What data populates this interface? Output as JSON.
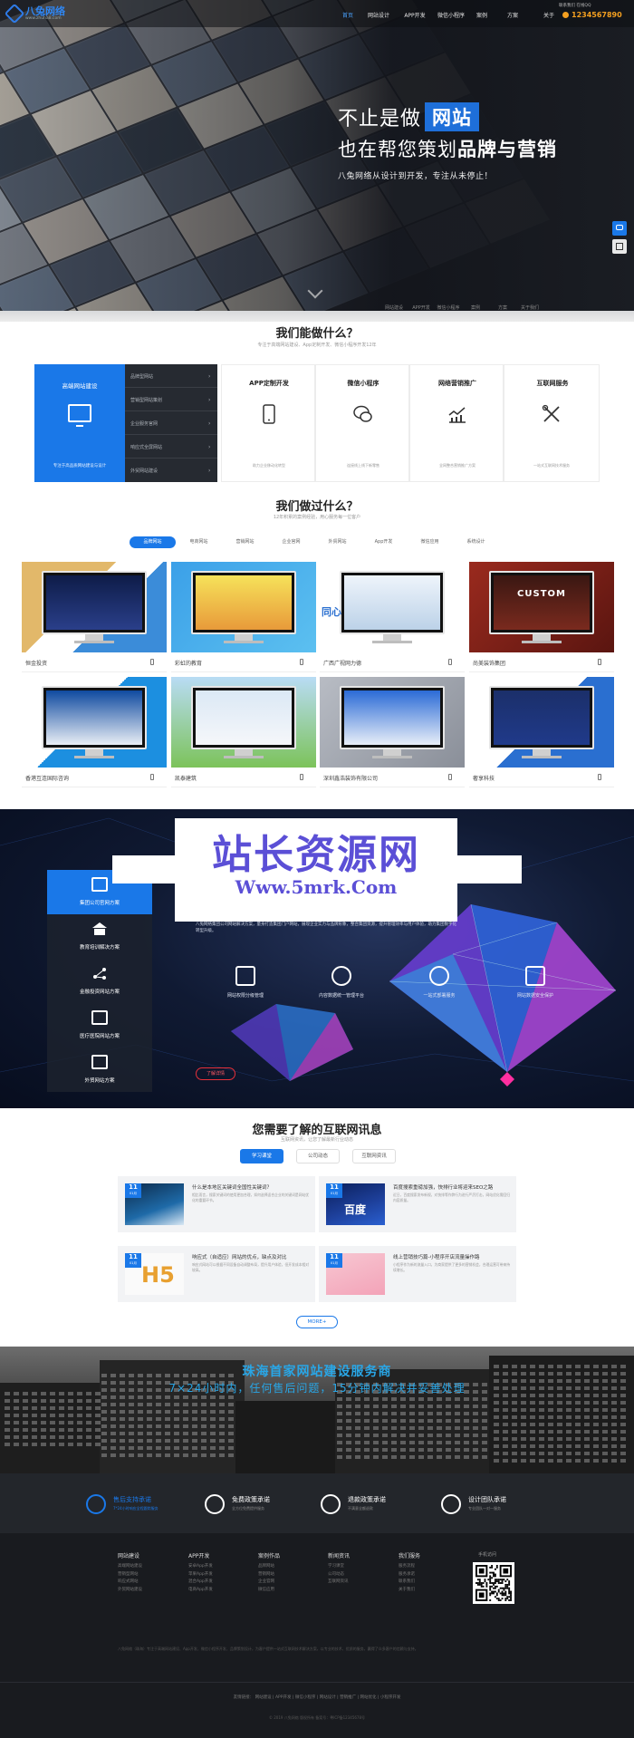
{
  "header": {
    "logo_text": "八兔网络",
    "logo_sub": "www.zhuha8.com",
    "contact_top": "联系我们  在线QQ",
    "phone": "1234567890",
    "nav": [
      "首页",
      "网站设计",
      "APP开发",
      "微信小程序",
      "案例",
      "方案",
      "关于"
    ]
  },
  "hero": {
    "line1_prefix": "不止是做",
    "line1_badge": "网站",
    "line2_prefix": "也在帮您策划",
    "line2_bold": "品牌与营销",
    "line3": "八兔网络从设计到开发，专注从未停止！",
    "footnav": [
      "网站建设",
      "APP开发",
      "微信小程序",
      "案例",
      "方案",
      "关于我们"
    ]
  },
  "services": {
    "title": "我们能做什么？",
    "subtitle": "专注于高端网站建设、App定制开发、微信小程序开发12年",
    "featured_title": "高端网站建设",
    "featured_note": "专注于高品质网站建设与设计",
    "menu": [
      "品牌型网站",
      "营销型网站策划",
      "企业服务官网",
      "响应式全屏网站",
      "外贸网站建设"
    ],
    "cards": [
      {
        "title": "APP定制开发",
        "desc": "助力企业移动化转型"
      },
      {
        "title": "微信小程序",
        "desc": "连接线上线下新零售"
      },
      {
        "title": "网络营销推广",
        "desc": "全网整合营销推广方案"
      },
      {
        "title": "互联网服务",
        "desc": "一站式互联网技术服务"
      }
    ]
  },
  "portfolio": {
    "title": "我们做过什么？",
    "subtitle": "12年积累的案例经验，用心服务每一位客户",
    "tabs": [
      "品牌网站",
      "电商网站",
      "营销网站",
      "企业官网",
      "外贸网站",
      "App开发",
      "微信应用",
      "系统设计"
    ],
    "items": [
      {
        "name": "恒金投资"
      },
      {
        "name": "彩虹的教育"
      },
      {
        "name": "广西广视网力德"
      },
      {
        "name": "尚美装饰集团"
      },
      {
        "name": "香港互连国际咨询"
      },
      {
        "name": "凯泰建筑"
      },
      {
        "name": "深圳鑫浩装饰有限公司"
      },
      {
        "name": "奢享科技"
      }
    ],
    "case_texts": [
      "CUSTOM",
      "同心"
    ]
  },
  "solutions": {
    "watermark_title": "站长资源网",
    "watermark_url": "Www.5mrk.Com",
    "menu": [
      "集团公司官网方案",
      "教育培训解决方案",
      "金融投资网站方案",
      "医疗医院网站方案",
      "外贸网站方案"
    ],
    "desc": "八兔网络集团公司网站解决方案，量身打造集团门户网站，展现企业实力与品牌形象，整合集团资源，提升管理效率与用户体验，助力集团数字化转型升级。",
    "features": [
      "网站权限分级管理",
      "内容数据统一管理平台",
      "一站式部署服务",
      "网站数据安全保护"
    ],
    "button": "了解详情"
  },
  "news": {
    "title": "您需要了解的互联网讯息",
    "subtitle": "互联网资讯，让您了解最新行业动态",
    "tabs": [
      "学习课堂",
      "公司动态",
      "互联网资讯"
    ],
    "items": [
      {
        "day": "11",
        "month": "01月",
        "title": "什么是本地区关键词全国性关键词？",
        "summary": "相比而言，搜索关键词的使用更加合理，如何选择适合企业的关键词是网站优化的重要环节。"
      },
      {
        "day": "11",
        "month": "01月",
        "title": "百度搜索重磅加强，快排行业将迎来SEO之路",
        "summary": "近日，百度搜索发布新规，对快排等作弊行为进行严厉打击，网站优化需回归内容质量。"
      },
      {
        "day": "11",
        "month": "01月",
        "title": "响应式（自适应）网站的优点，缺点及对比",
        "summary": "响应式网站可以根据不同设备自动调整布局，提升用户体验，但开发成本相对较高。"
      },
      {
        "day": "11",
        "month": "01月",
        "title": "线上营销技巧篇-小程序开店流量操作路",
        "summary": "小程序作为新的流量入口，为商家提供了更多的营销机会，合理运营可带来持续增长。"
      }
    ],
    "more": "MORE+"
  },
  "city": {
    "line1": "珠海首家网站建设服务商",
    "line2": "7×24小时内，任何售后问题，15分钟内解决并妥善处理"
  },
  "promises": [
    {
      "title": "售后支持承诺",
      "sub": "7*24小时响应全程跟踪服务"
    },
    {
      "title": "免费政策承诺",
      "sub": "全方位免费提供服务"
    },
    {
      "title": "退款政策承诺",
      "sub": "不满意全额退款"
    },
    {
      "title": "设计团队承诺",
      "sub": "专业团队一对一服务"
    }
  ],
  "footer": {
    "columns": [
      {
        "head": "网站建设",
        "links": [
          "高端网站建设",
          "营销型网站",
          "响应式网站",
          "外贸网站建设"
        ]
      },
      {
        "head": "APP开发",
        "links": [
          "安卓App开发",
          "苹果App开发",
          "混合App开发",
          "电商App开发"
        ]
      },
      {
        "head": "案例作品",
        "links": [
          "品牌网站",
          "营销网站",
          "企业官网",
          "微信应用"
        ]
      },
      {
        "head": "新闻资讯",
        "links": [
          "学习课堂",
          "公司动态",
          "互联网资讯"
        ]
      },
      {
        "head": "我们服务",
        "links": [
          "服务流程",
          "服务承诺",
          "联系我们",
          "关于我们"
        ]
      }
    ],
    "qr_title": "手机访问",
    "desc": "八兔网络（珠海）专注于高端网站建设、App开发、微信小程序开发、品牌策划设计，为客户提供一站式互联网技术解决方案，以专业的技术、优质的服务，赢得了众多客户的信赖与支持。",
    "links": "友情链接：  网站建设  |  APP开发  |  微信小程序  |  网站设计  |  营销推广  |  网站优化  |  小程序开发",
    "copyright": "© 2019 八兔网络 版权所有  备案号：粤ICP备12345678号"
  }
}
